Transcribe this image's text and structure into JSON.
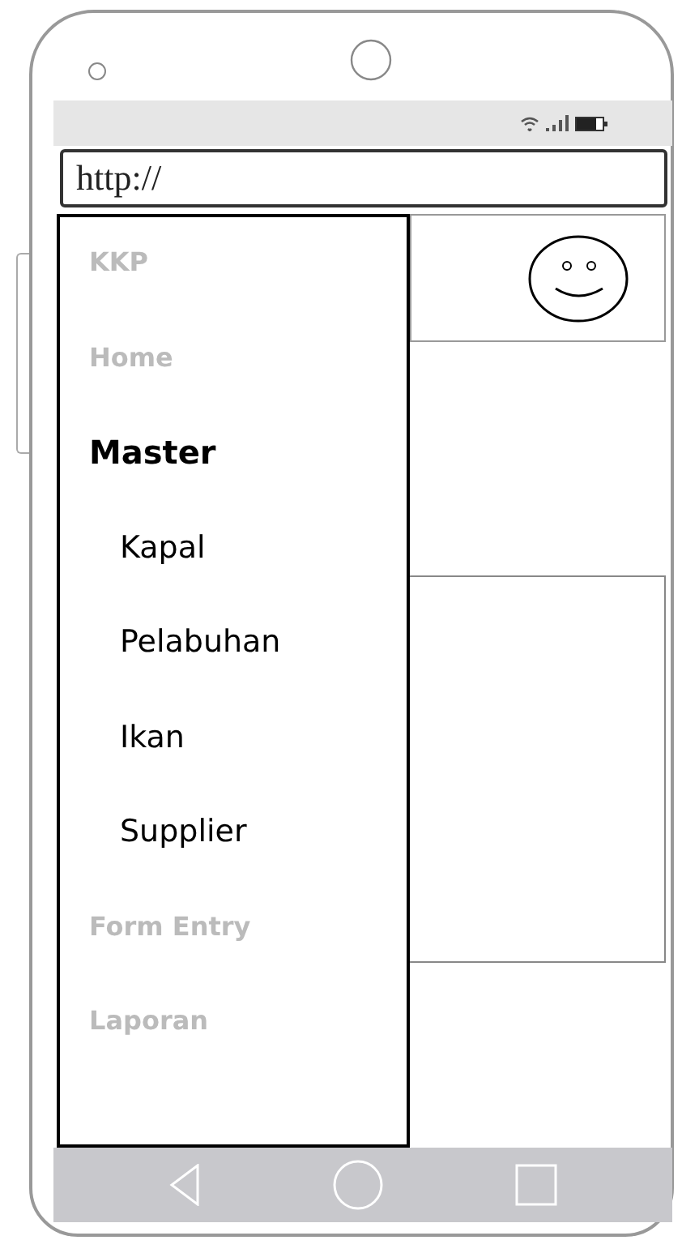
{
  "browser": {
    "url": "http://"
  },
  "drawer": {
    "items": [
      {
        "label": "KKP",
        "kind": "section",
        "selected": false
      },
      {
        "label": "Home",
        "kind": "section",
        "selected": false
      },
      {
        "label": "Master",
        "kind": "section",
        "selected": true,
        "children": [
          {
            "label": "Kapal",
            "kind": "subitem"
          },
          {
            "label": "Pelabuhan",
            "kind": "subitem"
          },
          {
            "label": "Ikan",
            "kind": "subitem"
          },
          {
            "label": "Supplier",
            "kind": "subitem"
          }
        ]
      },
      {
        "label": "Form Entry",
        "kind": "section",
        "selected": false
      },
      {
        "label": "Laporan",
        "kind": "section",
        "selected": false
      }
    ]
  }
}
